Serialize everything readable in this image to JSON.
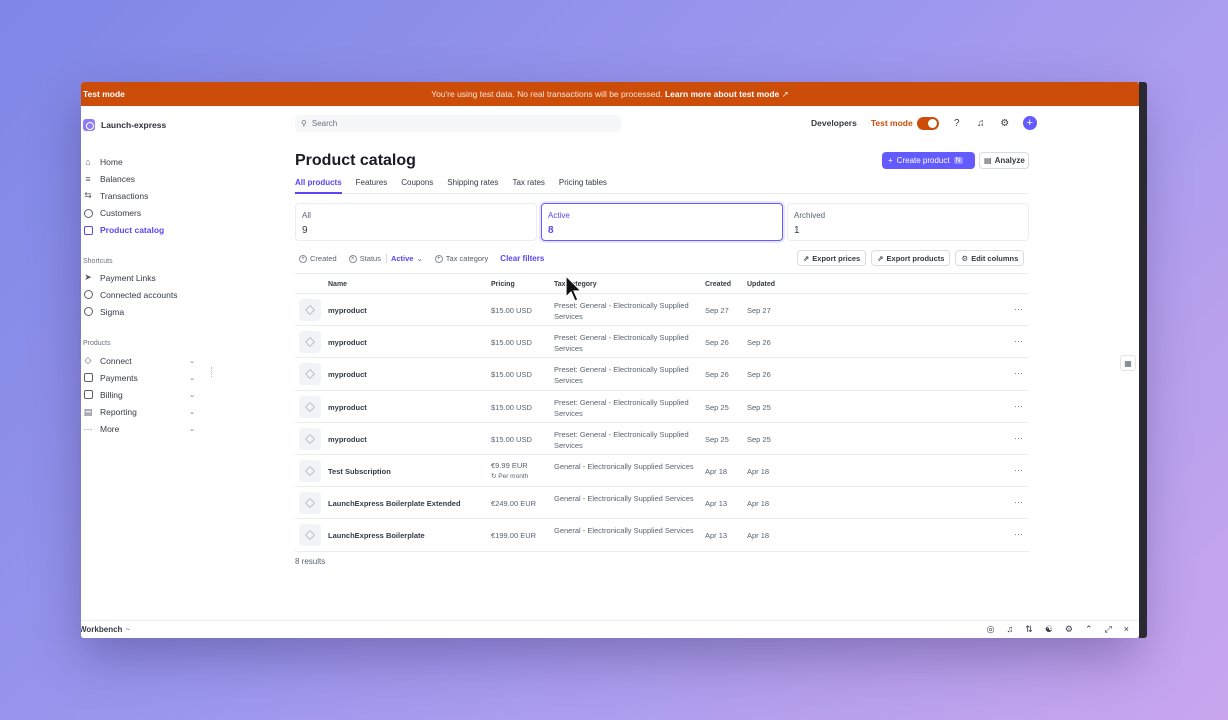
{
  "banner": {
    "label": "Test mode",
    "message": "You're using test data. No real transactions will be processed.",
    "link": "Learn more about test mode",
    "color": "#cc4d0a"
  },
  "account": {
    "name": "Launch-express"
  },
  "sidebar": {
    "main": [
      {
        "label": "Home",
        "icon": "home-icon"
      },
      {
        "label": "Balances",
        "icon": "balances-icon"
      },
      {
        "label": "Transactions",
        "icon": "transactions-icon"
      },
      {
        "label": "Customers",
        "icon": "customers-icon"
      },
      {
        "label": "Product catalog",
        "icon": "product-catalog-icon",
        "active": true
      }
    ],
    "shortcuts_title": "Shortcuts",
    "shortcuts": [
      {
        "label": "Payment Links",
        "icon": "rocket-icon"
      },
      {
        "label": "Connected accounts",
        "icon": "connected-accounts-icon"
      },
      {
        "label": "Sigma",
        "icon": "sigma-icon"
      }
    ],
    "products_title": "Products",
    "products": [
      {
        "label": "Connect",
        "icon": "connect-icon"
      },
      {
        "label": "Payments",
        "icon": "payments-icon"
      },
      {
        "label": "Billing",
        "icon": "billing-icon"
      },
      {
        "label": "Reporting",
        "icon": "reporting-icon"
      },
      {
        "label": "More",
        "icon": "more-icon"
      }
    ]
  },
  "topbar": {
    "search_placeholder": "Search",
    "developers": "Developers",
    "test_mode": "Test mode"
  },
  "page": {
    "title": "Product catalog",
    "create_button": "Create product",
    "create_shortcut": "N",
    "analyze_button": "Analyze",
    "accent": "#635bff"
  },
  "tabs": [
    {
      "label": "All products",
      "active": true
    },
    {
      "label": "Features"
    },
    {
      "label": "Coupons"
    },
    {
      "label": "Shipping rates"
    },
    {
      "label": "Tax rates"
    },
    {
      "label": "Pricing tables"
    }
  ],
  "summary_cards": [
    {
      "label": "All",
      "count": "9"
    },
    {
      "label": "Active",
      "count": "8",
      "active": true
    },
    {
      "label": "Archived",
      "count": "1"
    }
  ],
  "filters": {
    "created": "Created",
    "status": "Status",
    "status_value": "Active",
    "tax_category": "Tax category",
    "clear": "Clear filters"
  },
  "actions": {
    "export_prices": "Export prices",
    "export_products": "Export products",
    "edit_columns": "Edit columns"
  },
  "table": {
    "columns": {
      "name": "Name",
      "pricing": "Pricing",
      "tax": "Tax category",
      "created": "Created",
      "updated": "Updated"
    },
    "rows": [
      {
        "name": "myproduct",
        "price": "$15.00 USD",
        "price_sub": "",
        "tax": "Preset: General - Electronically Supplied Services",
        "created": "Sep 27",
        "updated": "Sep 27"
      },
      {
        "name": "myproduct",
        "price": "$15.00 USD",
        "price_sub": "",
        "tax": "Preset: General - Electronically Supplied Services",
        "created": "Sep 26",
        "updated": "Sep 26"
      },
      {
        "name": "myproduct",
        "price": "$15.00 USD",
        "price_sub": "",
        "tax": "Preset: General - Electronically Supplied Services",
        "created": "Sep 26",
        "updated": "Sep 26"
      },
      {
        "name": "myproduct",
        "price": "$15.00 USD",
        "price_sub": "",
        "tax": "Preset: General - Electronically Supplied Services",
        "created": "Sep 25",
        "updated": "Sep 25"
      },
      {
        "name": "myproduct",
        "price": "$15.00 USD",
        "price_sub": "",
        "tax": "Preset: General - Electronically Supplied Services",
        "created": "Sep 25",
        "updated": "Sep 25"
      },
      {
        "name": "Test Subscription",
        "price": "€9.99 EUR",
        "price_sub": "Per month",
        "tax": "General - Electronically Supplied Services",
        "created": "Apr 18",
        "updated": "Apr 18"
      },
      {
        "name": "LaunchExpress Boilerplate Extended",
        "price": "€249.00 EUR",
        "price_sub": "",
        "tax": "General - Electronically Supplied Services",
        "created": "Apr 13",
        "updated": "Apr 18"
      },
      {
        "name": "LaunchExpress Boilerplate",
        "price": "€199.00 EUR",
        "price_sub": "",
        "tax": "General - Electronically Supplied Services",
        "created": "Apr 13",
        "updated": "Apr 18"
      }
    ],
    "results": "8 results"
  },
  "workbench": {
    "label": "Workbench",
    "chevron": "~"
  }
}
